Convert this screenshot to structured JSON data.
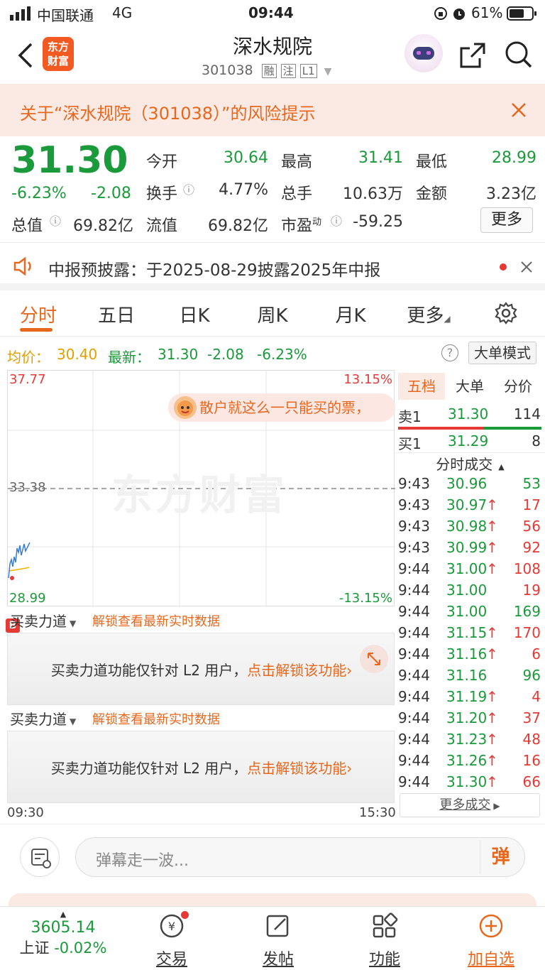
{
  "status_bar": {
    "carrier": "中国联通",
    "network": "4G",
    "time": "09:44",
    "battery": "61%"
  },
  "header": {
    "logo_text_1": "东方",
    "logo_text_2": "财富",
    "title": "深水规院",
    "code": "301038",
    "badge_rong": "融",
    "badge_zhu": "注",
    "badge_level": "L1"
  },
  "risk_banner": {
    "text": "关于“深水规院（301038）”的风险提示"
  },
  "quote": {
    "price": "31.30",
    "change_pct": "-6.23%",
    "change": "-2.08",
    "open_label": "今开",
    "open": "30.64",
    "high_label": "最高",
    "high": "31.41",
    "low_label": "最低",
    "low": "28.99",
    "turnover_label": "换手",
    "turnover": "4.77%",
    "volume_label": "总手",
    "volume": "10.63万",
    "amount_label": "金额",
    "amount": "3.23亿",
    "mcap_label": "总值",
    "mcap": "69.82亿",
    "float_label": "流值",
    "float": "69.82亿",
    "pe_label": "市盈",
    "pe_sup": "动",
    "pe": "-59.25",
    "more_button": "更多"
  },
  "notice": {
    "text": "中报预披露：于2025-08-29披露2025年中报"
  },
  "tabs": [
    "分时",
    "五日",
    "日K",
    "周K",
    "月K",
    "更多"
  ],
  "price_line": {
    "avg_label": "均价：",
    "avg": "30.40",
    "latest_label": "最新：",
    "latest": "31.30",
    "change": "-2.08",
    "change_pct": "-6.23%",
    "big_order_mode": "大单模式"
  },
  "chart": {
    "y_top": "37.77",
    "y_mid": "33.38",
    "y_bottom": "28.99",
    "pct_top": "13.15%",
    "pct_bottom": "-13.15%",
    "watermark": "东方财富",
    "danmaku": "散户就这么一只能买的票，",
    "time_start": "09:30",
    "time_end": "15:30",
    "colors": {
      "price_line": "#3a7bd5",
      "avg_line": "#f0b400",
      "mid_dash": "#888888"
    }
  },
  "force_panels": [
    {
      "dropdown": "买卖力道",
      "unlock_link": "解锁查看最新实时数据",
      "message": "买卖力道功能仅针对 L2 用户，",
      "cta": "点击解锁该功能"
    },
    {
      "dropdown": "买卖力道",
      "unlock_link": "解锁查看最新实时数据",
      "message": "买卖力道功能仅针对 L2 用户，",
      "cta": "点击解锁该功能"
    }
  ],
  "orderbook": {
    "tabs": [
      "五档",
      "大单",
      "分价"
    ],
    "sell1": {
      "label": "卖1",
      "price": "31.30",
      "vol": "114"
    },
    "buy1": {
      "label": "买1",
      "price": "31.29",
      "vol": "8"
    },
    "trades_title": "分时成交",
    "trades": [
      {
        "time": "9:43",
        "price": "30.96",
        "arrow": "",
        "vol": "53",
        "vol_color": "green"
      },
      {
        "time": "9:43",
        "price": "30.97",
        "arrow": "↑",
        "vol": "17",
        "vol_color": "red"
      },
      {
        "time": "9:43",
        "price": "30.98",
        "arrow": "↑",
        "vol": "56",
        "vol_color": "red"
      },
      {
        "time": "9:43",
        "price": "30.99",
        "arrow": "↑",
        "vol": "92",
        "vol_color": "red"
      },
      {
        "time": "9:44",
        "price": "31.00",
        "arrow": "↑",
        "vol": "108",
        "vol_color": "red"
      },
      {
        "time": "9:44",
        "price": "31.00",
        "arrow": "",
        "vol": "19",
        "vol_color": "red"
      },
      {
        "time": "9:44",
        "price": "31.00",
        "arrow": "",
        "vol": "169",
        "vol_color": "green"
      },
      {
        "time": "9:44",
        "price": "31.15",
        "arrow": "↑",
        "vol": "170",
        "vol_color": "red"
      },
      {
        "time": "9:44",
        "price": "31.16",
        "arrow": "↑",
        "vol": "6",
        "vol_color": "red"
      },
      {
        "time": "9:44",
        "price": "31.16",
        "arrow": "",
        "vol": "96",
        "vol_color": "green"
      },
      {
        "time": "9:44",
        "price": "31.19",
        "arrow": "↑",
        "vol": "4",
        "vol_color": "red"
      },
      {
        "time": "9:44",
        "price": "31.20",
        "arrow": "↑",
        "vol": "37",
        "vol_color": "red"
      },
      {
        "time": "9:44",
        "price": "31.23",
        "arrow": "↑",
        "vol": "48",
        "vol_color": "red"
      },
      {
        "time": "9:44",
        "price": "31.26",
        "arrow": "↑",
        "vol": "16",
        "vol_color": "red"
      },
      {
        "time": "9:44",
        "price": "31.30",
        "arrow": "↑",
        "vol": "66",
        "vol_color": "red"
      }
    ],
    "more_trades": "更多成交"
  },
  "comment_bar": {
    "placeholder": "弹幕走一波...",
    "danmaku_button": "弹"
  },
  "bottom_nav": {
    "index_value": "3605.14",
    "index_name": "上证",
    "index_change": "-0.02%",
    "trade": "交易",
    "post": "发帖",
    "functions": "功能",
    "add_watch": "加自选"
  }
}
